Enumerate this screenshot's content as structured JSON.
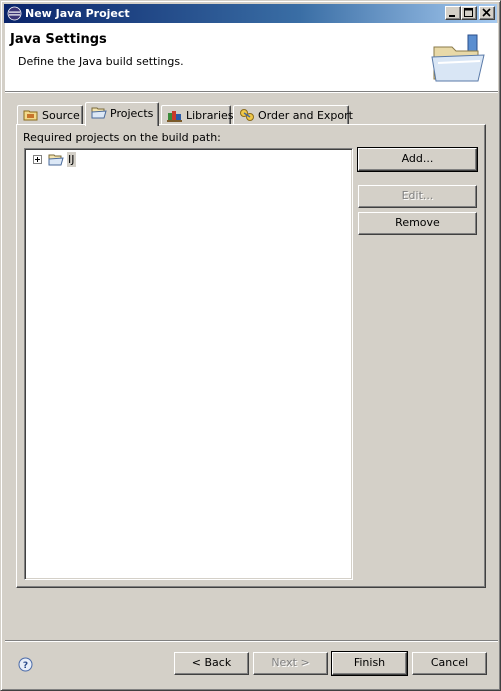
{
  "window": {
    "title": "New Java Project",
    "icon": "eclipse-icon",
    "controls": [
      "minimize-icon",
      "maximize-icon",
      "close-icon"
    ]
  },
  "header": {
    "title": "Java Settings",
    "description": "Define the Java build settings.",
    "image": "folder-java-wizard-icon"
  },
  "tabs": [
    {
      "label": "Source",
      "icon": "source-folder-icon",
      "active": false
    },
    {
      "label": "Projects",
      "icon": "open-folder-icon",
      "active": true
    },
    {
      "label": "Libraries",
      "icon": "books-icon",
      "active": false
    },
    {
      "label": "Order and Export",
      "icon": "order-arrows-icon",
      "active": false
    }
  ],
  "projects_panel": {
    "label": "Required projects on the build path:",
    "tree_items": [
      {
        "label": "IJ",
        "icon": "project-folder-icon",
        "expanded": false,
        "selected": true
      }
    ],
    "buttons": {
      "add": "Add...",
      "edit": "Edit...",
      "remove": "Remove"
    }
  },
  "footer": {
    "help_icon": "help-icon",
    "back": "< Back",
    "next": "Next >",
    "finish": "Finish",
    "cancel": "Cancel"
  },
  "colors": {
    "titlebar_start": "#0a246a",
    "titlebar_end": "#a6caf0",
    "face": "#d4d0c8",
    "disabled_text": "#808080"
  }
}
